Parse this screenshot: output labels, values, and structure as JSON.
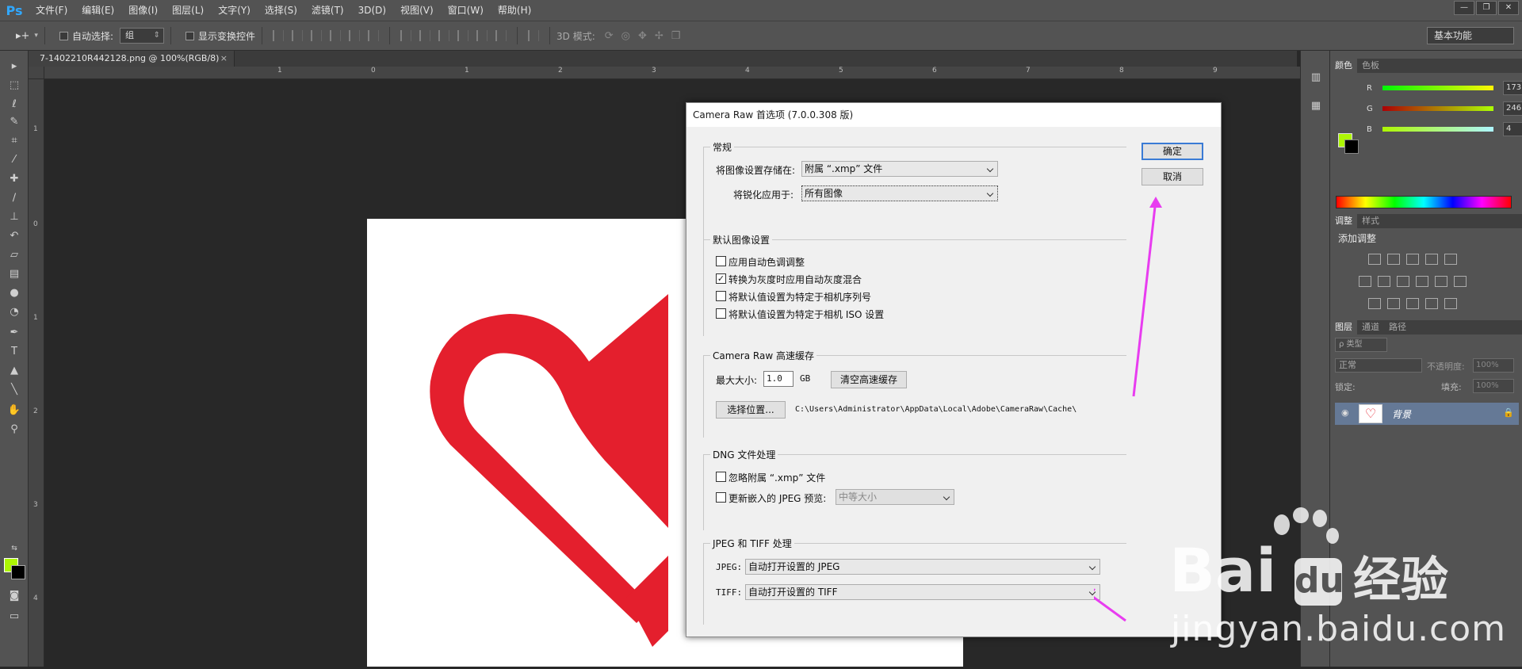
{
  "app": {
    "logo": "Ps",
    "menu": [
      "文件(F)",
      "编辑(E)",
      "图像(I)",
      "图层(L)",
      "文字(Y)",
      "选择(S)",
      "滤镜(T)",
      "3D(D)",
      "视图(V)",
      "窗口(W)",
      "帮助(H)"
    ],
    "window_controls": [
      "—",
      "❐",
      "✕"
    ]
  },
  "options": {
    "move_tool": "▸+",
    "auto_select_label": "自动选择:",
    "auto_select_value": "组",
    "show_transform_label": "显示变换控件",
    "mode_3d_label": "3D 模式:",
    "workspace": "基本功能"
  },
  "document": {
    "tab_title": "7-1402210R442128.png @ 100%(RGB/8)",
    "tab_close": "×",
    "ruler_h": [
      "1",
      "0",
      "1",
      "2",
      "3",
      "4",
      "5",
      "6",
      "7",
      "8",
      "9"
    ],
    "ruler_v": [
      "1",
      "0",
      "1",
      "2",
      "3",
      "4"
    ]
  },
  "panels": {
    "color_tabs": [
      "颜色",
      "色板"
    ],
    "channels": [
      {
        "label": "R",
        "value": "173"
      },
      {
        "label": "G",
        "value": "246"
      },
      {
        "label": "B",
        "value": "4"
      }
    ],
    "adjust_tabs": [
      "调整",
      "样式"
    ],
    "adjust_title": "添加调整",
    "layers_tabs": [
      "图层",
      "通道",
      "路径"
    ],
    "layer_filter": "ρ 类型",
    "blend_mode": "正常",
    "opacity_label": "不透明度:",
    "opacity_value": "100%",
    "lock_label": "锁定:",
    "fill_label": "填充:",
    "fill_value": "100%",
    "layer_name": "背景"
  },
  "dialog": {
    "title": "Camera Raw 首选项  (7.0.0.308 版)",
    "ok": "确定",
    "cancel": "取消",
    "general": {
      "title": "常规",
      "save_label": "将图像设置存储在:",
      "save_value": "附属 “.xmp” 文件",
      "sharpen_label": "将锐化应用于:",
      "sharpen_value": "所有图像"
    },
    "defaults": {
      "title": "默认图像设置",
      "items": [
        {
          "label": "应用自动色调调整",
          "checked": false
        },
        {
          "label": "转换为灰度时应用自动灰度混合",
          "checked": true
        },
        {
          "label": "将默认值设置为特定于相机序列号",
          "checked": false
        },
        {
          "label": "将默认值设置为特定于相机 ISO 设置",
          "checked": false
        }
      ]
    },
    "cache": {
      "title": "Camera Raw 高速缓存",
      "max_label": "最大大小:",
      "max_value": "1.0",
      "unit": "GB",
      "purge": "清空高速缓存",
      "select_loc": "选择位置...",
      "path": "C:\\Users\\Administrator\\AppData\\Local\\Adobe\\CameraRaw\\Cache\\"
    },
    "dng": {
      "title": "DNG 文件处理",
      "ignore_label": "忽略附属 “.xmp” 文件",
      "update_label": "更新嵌入的 JPEG 预览:",
      "update_value": "中等大小"
    },
    "jpeg_tiff": {
      "title": "JPEG 和 TIFF 处理",
      "jpeg_label": "JPEG:",
      "jpeg_value": "自动打开设置的 JPEG",
      "tiff_label": "TIFF:",
      "tiff_value": "自动打开设置的 TIFF"
    }
  },
  "watermark": {
    "brand_a": "Bai",
    "brand_b": "经验",
    "url": "jingyan.baidu.com"
  },
  "colors": {
    "foreground": "#adf604",
    "heart_red": "#e41f2d",
    "arrow_magenta": "#e83cf0",
    "accent_blue": "#3a7bd5"
  }
}
